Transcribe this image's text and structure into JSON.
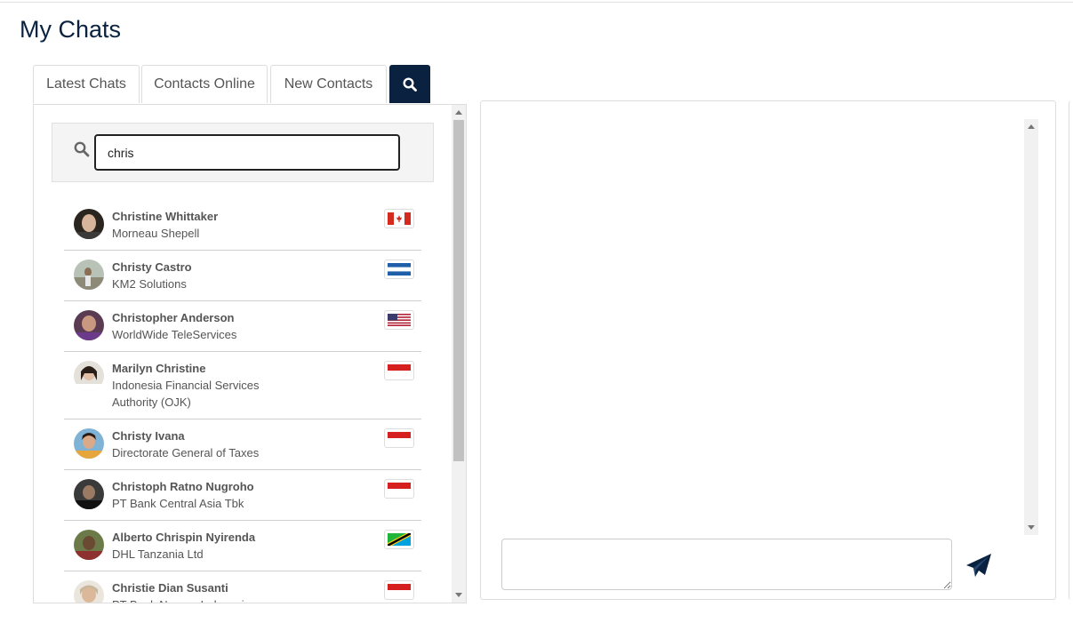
{
  "page": {
    "title": "My Chats"
  },
  "tabs": [
    {
      "label": "Latest Chats"
    },
    {
      "label": "Contacts Online"
    },
    {
      "label": "New Contacts"
    },
    {
      "icon": "search-icon"
    }
  ],
  "search": {
    "value": "chris",
    "icon": "search-icon"
  },
  "contacts": [
    {
      "name": "Christine Whittaker",
      "org": "Morneau Shepell",
      "flag": "canada-flag"
    },
    {
      "name": "Christy Castro",
      "org": "KM2 Solutions",
      "flag": "honduras-flag"
    },
    {
      "name": "Christopher Anderson",
      "org": "WorldWide TeleServices",
      "flag": "usa-flag"
    },
    {
      "name": "Marilyn Christine",
      "org": "Indonesia Financial Services Authority (OJK)",
      "flag": "indonesia-flag"
    },
    {
      "name": "Christy Ivana",
      "org": "Directorate General of Taxes",
      "flag": "indonesia-flag"
    },
    {
      "name": "Christoph Ratno Nugroho",
      "org": "PT Bank Central Asia Tbk",
      "flag": "indonesia-flag"
    },
    {
      "name": "Alberto Chrispin Nyirenda",
      "org": "DHL Tanzania Ltd",
      "flag": "tanzania-flag"
    },
    {
      "name": "Christie Dian Susanti",
      "org": "PT Bank Negara Indonesia",
      "flag": "indonesia-flag"
    }
  ],
  "chat": {
    "message_value": "",
    "send_icon": "paper-plane-icon"
  },
  "colors": {
    "brand_navy": "#0a2240",
    "text": "#555555",
    "border": "#dddddd"
  }
}
